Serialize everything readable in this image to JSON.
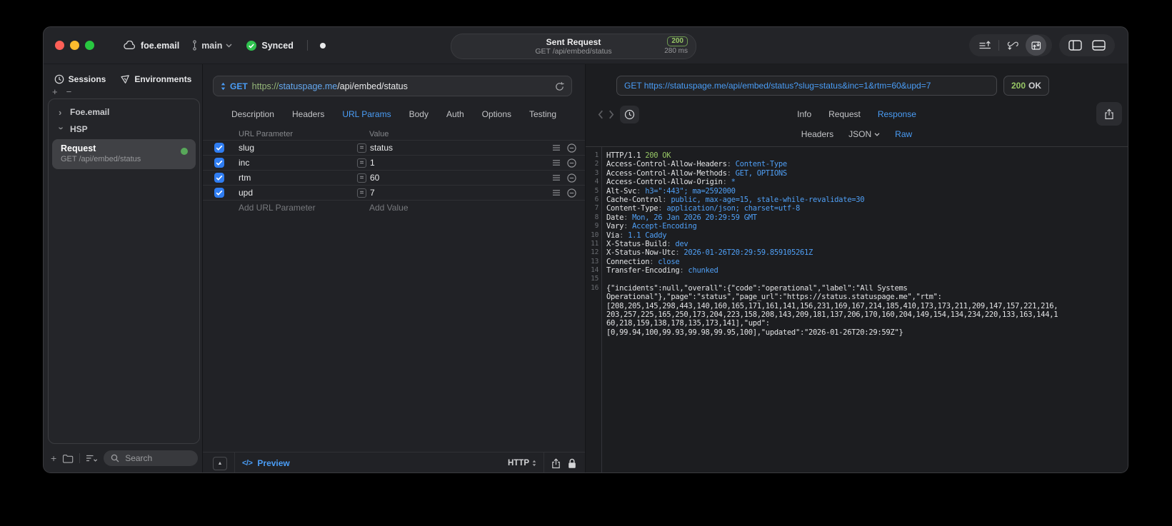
{
  "window": {
    "titlebar": {
      "project": "foe.email",
      "branch": "main",
      "sync_label": "Synced",
      "request_title": "Sent Request",
      "request_subtitle": "GET /api/embed/status",
      "status_code": "200",
      "duration": "280 ms"
    },
    "sidebar": {
      "tabs": [
        {
          "label": "Sessions",
          "icon": "clock-icon"
        },
        {
          "label": "Environments",
          "icon": "environment-icon"
        }
      ],
      "tree": [
        {
          "label": "Foe.email",
          "expanded": false
        },
        {
          "label": "HSP",
          "expanded": true
        }
      ],
      "request_item": {
        "title": "Request",
        "subtitle": "GET /api/embed/status"
      },
      "search_placeholder": "Search"
    },
    "request_pane": {
      "method": "GET",
      "url": {
        "scheme": "https://",
        "host": "statuspage.me",
        "path": "/api/embed/status"
      },
      "tabs": [
        "Description",
        "Headers",
        "URL Params",
        "Body",
        "Auth",
        "Options",
        "Testing"
      ],
      "active_tab": "URL Params",
      "params": {
        "columns": [
          "URL Parameter",
          "Value"
        ],
        "rows": [
          {
            "checked": true,
            "name": "slug",
            "value": "status"
          },
          {
            "checked": true,
            "name": "inc",
            "value": "1"
          },
          {
            "checked": true,
            "name": "rtm",
            "value": "60"
          },
          {
            "checked": true,
            "name": "upd",
            "value": "7"
          }
        ],
        "add_name": "Add URL Parameter",
        "add_value": "Add Value"
      },
      "bottom_bar": {
        "code_glyph": "</>",
        "preview": "Preview",
        "protocol": "HTTP"
      }
    },
    "response_pane": {
      "request_line": "GET https://statuspage.me/api/embed/status?slug=status&inc=1&rtm=60&upd=7",
      "status": {
        "code": "200",
        "text": "OK"
      },
      "tabs": [
        "Info",
        "Request",
        "Response"
      ],
      "active_tab": "Response",
      "subtabs": [
        "Headers",
        "JSON",
        "Raw"
      ],
      "active_subtab": "Raw",
      "code_lines": [
        {
          "num": "1",
          "parts": [
            {
              "t": "HTTP/1.1 ",
              "c": "p"
            },
            {
              "t": "200 OK",
              "c": "g"
            }
          ]
        },
        {
          "num": "2",
          "parts": [
            {
              "t": "Access-Control-Allow-Headers",
              "c": "p"
            },
            {
              "t": ": ",
              "c": "d"
            },
            {
              "t": "Content-Type",
              "c": "b"
            }
          ]
        },
        {
          "num": "3",
          "parts": [
            {
              "t": "Access-Control-Allow-Methods",
              "c": "p"
            },
            {
              "t": ": ",
              "c": "d"
            },
            {
              "t": "GET, OPTIONS",
              "c": "b"
            }
          ]
        },
        {
          "num": "4",
          "parts": [
            {
              "t": "Access-Control-Allow-Origin",
              "c": "p"
            },
            {
              "t": ": ",
              "c": "d"
            },
            {
              "t": "*",
              "c": "b"
            }
          ]
        },
        {
          "num": "5",
          "parts": [
            {
              "t": "Alt-Svc",
              "c": "p"
            },
            {
              "t": ": ",
              "c": "d"
            },
            {
              "t": "h3=\":443\"; ma=2592000",
              "c": "b"
            }
          ]
        },
        {
          "num": "6",
          "parts": [
            {
              "t": "Cache-Control",
              "c": "p"
            },
            {
              "t": ": ",
              "c": "d"
            },
            {
              "t": "public, max-age=15, stale-while-revalidate=30",
              "c": "b"
            }
          ]
        },
        {
          "num": "7",
          "parts": [
            {
              "t": "Content-Type",
              "c": "p"
            },
            {
              "t": ": ",
              "c": "d"
            },
            {
              "t": "application/json; charset=utf-8",
              "c": "b"
            }
          ]
        },
        {
          "num": "8",
          "parts": [
            {
              "t": "Date",
              "c": "p"
            },
            {
              "t": ": ",
              "c": "d"
            },
            {
              "t": "Mon, 26 Jan 2026 20:29:59 GMT",
              "c": "b"
            }
          ]
        },
        {
          "num": "9",
          "parts": [
            {
              "t": "Vary",
              "c": "p"
            },
            {
              "t": ": ",
              "c": "d"
            },
            {
              "t": "Accept-Encoding",
              "c": "b"
            }
          ]
        },
        {
          "num": "10",
          "parts": [
            {
              "t": "Via",
              "c": "p"
            },
            {
              "t": ": ",
              "c": "d"
            },
            {
              "t": "1.1 Caddy",
              "c": "b"
            }
          ]
        },
        {
          "num": "11",
          "parts": [
            {
              "t": "X-Status-Build",
              "c": "p"
            },
            {
              "t": ": ",
              "c": "d"
            },
            {
              "t": "dev",
              "c": "b"
            }
          ]
        },
        {
          "num": "12",
          "parts": [
            {
              "t": "X-Status-Now-Utc",
              "c": "p"
            },
            {
              "t": ": ",
              "c": "d"
            },
            {
              "t": "2026-01-26T20:29:59.859105261Z",
              "c": "b"
            }
          ]
        },
        {
          "num": "13",
          "parts": [
            {
              "t": "Connection",
              "c": "p"
            },
            {
              "t": ": ",
              "c": "d"
            },
            {
              "t": "close",
              "c": "b"
            }
          ]
        },
        {
          "num": "14",
          "parts": [
            {
              "t": "Transfer-Encoding",
              "c": "p"
            },
            {
              "t": ": ",
              "c": "d"
            },
            {
              "t": "chunked",
              "c": "b"
            }
          ]
        },
        {
          "num": "15",
          "parts": []
        },
        {
          "num": "16",
          "parts": [
            {
              "t": "{\"incidents\":null,\"overall\":{\"code\":\"operational\",\"label\":\"All Systems",
              "c": "p"
            }
          ]
        },
        {
          "num": "",
          "parts": [
            {
              "t": "Operational\"},\"page\":\"status\",\"page_url\":\"https://status.statuspage.me\",\"rtm\":",
              "c": "p"
            }
          ]
        },
        {
          "num": "",
          "parts": [
            {
              "t": "[208,205,145,298,443,140,160,165,171,161,141,156,231,169,167,214,185,410,173,173,211,209,147,157,221,216,",
              "c": "p"
            }
          ]
        },
        {
          "num": "",
          "parts": [
            {
              "t": "203,257,225,165,250,173,204,223,158,208,143,209,181,137,206,170,160,204,149,154,134,234,220,133,163,144,1",
              "c": "p"
            }
          ]
        },
        {
          "num": "",
          "parts": [
            {
              "t": "60,218,159,138,178,135,173,141],\"upd\":",
              "c": "p"
            }
          ]
        },
        {
          "num": "",
          "parts": [
            {
              "t": "[0,99.94,100,99.93,99.98,99.95,100],\"updated\":\"2026-01-26T20:29:59Z\"}",
              "c": "p"
            }
          ]
        }
      ]
    }
  },
  "colors": {
    "accent_blue": "#4a9df6",
    "status_green": "#97c765",
    "checkbox_blue": "#2f7df2",
    "sync_green": "#2fc14e",
    "request_dot_green": "#58a85a",
    "traffic_red": "#ff5f57",
    "traffic_yellow": "#febc2e",
    "traffic_green": "#28c840"
  }
}
